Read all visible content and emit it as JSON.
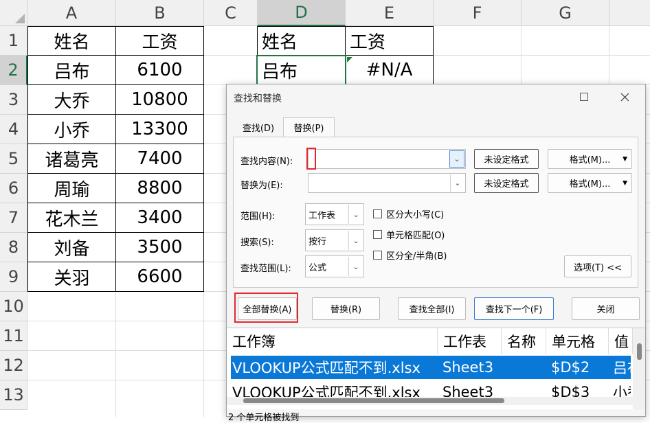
{
  "sheet": {
    "columns": [
      "A",
      "B",
      "C",
      "D",
      "E",
      "F",
      "G"
    ],
    "rows": [
      "1",
      "2",
      "3",
      "4",
      "5",
      "6",
      "7",
      "8",
      "9",
      "10",
      "11",
      "12",
      "13"
    ],
    "table1_header": {
      "name": "姓名",
      "salary": "工资"
    },
    "table1_rows": [
      {
        "name": "吕布",
        "salary": "6100"
      },
      {
        "name": "大乔",
        "salary": "10800"
      },
      {
        "name": "小乔",
        "salary": "13300"
      },
      {
        "name": "诸葛亮",
        "salary": "7400"
      },
      {
        "name": "周瑜",
        "salary": "8800"
      },
      {
        "name": "花木兰",
        "salary": "3400"
      },
      {
        "name": "刘备",
        "salary": "3500"
      },
      {
        "name": "关羽",
        "salary": "6600"
      }
    ],
    "table2_header": {
      "name": "姓名",
      "salary": "工资"
    },
    "table2_rows": [
      {
        "name": "吕布",
        "salary": "#N/A"
      }
    ],
    "active_cell": "D2"
  },
  "dialog": {
    "title": "查找和替换",
    "tabs": [
      {
        "label": "查找(D)",
        "active": false
      },
      {
        "label": "替换(P)",
        "active": true
      }
    ],
    "find_label": "查找内容(N):",
    "find_value": "",
    "replace_label": "替换为(E):",
    "replace_value": "",
    "format_status_find": "未设定格式",
    "format_status_replace": "未设定格式",
    "format_button": "格式(M)...",
    "scope_label": "范围(H):",
    "scope_value": "工作表",
    "search_label": "搜索(S):",
    "search_value": "按行",
    "lookin_label": "查找范围(L):",
    "lookin_value": "公式",
    "options": {
      "match_case": "区分大小写(C)",
      "match_entire_cell": "单元格匹配(O)",
      "match_byte": "区分全/半角(B)"
    },
    "options_button": "选项(T) <<",
    "buttons": {
      "replace_all": "全部替换(A)",
      "replace": "替换(R)",
      "find_all": "查找全部(I)",
      "find_next": "查找下一个(F)",
      "close": "关闭"
    },
    "results": {
      "headers": [
        "工作簿",
        "工作表",
        "名称",
        "单元格",
        "值"
      ],
      "rows": [
        {
          "book": "VLOOKUP公式匹配不到.xlsx",
          "sheet": "Sheet3",
          "name": "",
          "cell": "$D$2",
          "value": "吕布"
        },
        {
          "book": "VLOOKUP公式匹配不到.xlsx",
          "sheet": "Sheet3",
          "name": "",
          "cell": "$D$3",
          "value": "小乔"
        }
      ]
    },
    "status": "2 个单元格被找到"
  },
  "colors": {
    "accent_green": "#217346",
    "selection_blue": "#0a78d7",
    "highlight_red": "#e0282e"
  }
}
